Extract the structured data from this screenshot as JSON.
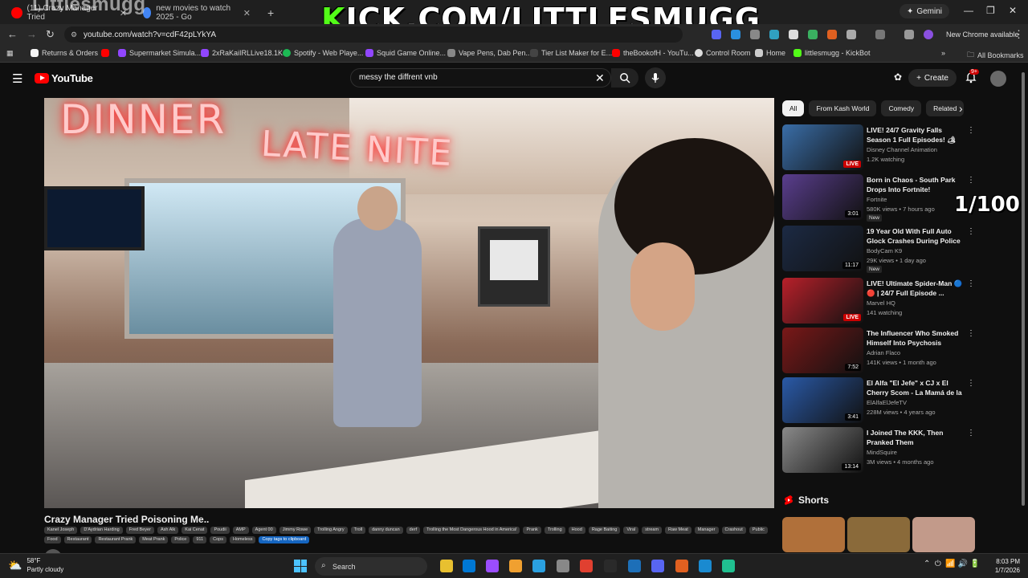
{
  "browser": {
    "tabs": [
      {
        "label": "(11) Crazy Manager Tried",
        "favicon_color": "#ff0000"
      },
      {
        "label": "new movies to watch 2025 - Go",
        "favicon_color": "#4285f4"
      }
    ],
    "new_tab_label": "+",
    "gemini_label": "Gemini",
    "url": "youtube.com/watch?v=cdF42pLYkYA",
    "new_chrome_label": "New Chrome available",
    "bookmarks": [
      {
        "label": "Returns & Orders",
        "color": "#f5f5f5"
      },
      {
        "label": "Supermarket Simula...",
        "color": "#9146ff"
      },
      {
        "label": "2xRaKaiIRLLive18.1K...",
        "color": "#9146ff"
      },
      {
        "label": "Spotify - Web Playe...",
        "color": "#1db954"
      },
      {
        "label": "Squid Game Online...",
        "color": "#9146ff"
      },
      {
        "label": "Vape Pens, Dab Pen...",
        "color": "#888888"
      },
      {
        "label": "Tier List Maker for E...",
        "color": "#444444"
      },
      {
        "label": "theBookofH - YouTu...",
        "color": "#ff0000"
      },
      {
        "label": "Control Room",
        "color": "#dddddd"
      },
      {
        "label": "Home",
        "color": "#cccccc"
      },
      {
        "label": "littlesmugg - KickBot",
        "color": "#53fc18"
      }
    ],
    "all_bookmarks_label": "All Bookmarks"
  },
  "stream_overlay": {
    "brand": "Littlesmugg",
    "kick_banner": "KICK.COM/LITTLESMUGG",
    "counter": "1/100"
  },
  "youtube": {
    "logo_text": "YouTube",
    "search_value": "messy the diffrent vnb",
    "create_label": "Create",
    "notification_count": "9+",
    "video_title": "Crazy Manager Tried Poisoning Me..",
    "sign_text_1": "DINNER",
    "sign_text_2": "LATE NITE",
    "tags": [
      "Kanel Joseph",
      "D'Aydrian Harding",
      "Fred Beyer",
      "Ash Alk",
      "Kai Cenat",
      "Poudii",
      "AMP",
      "Agent 00",
      "Jimmy Rowe",
      "Trolling Angry",
      "Troll",
      "danny duncan",
      "derf",
      "Trolling the Most Dangerous Hood in America!",
      "Prank",
      "Trolling",
      "Hood",
      "Rage Baiting",
      "Viral",
      "stream",
      "Raw Meat",
      "Manager",
      "Crashout",
      "Public",
      "Food",
      "Restaurant",
      "Restaurant Prank",
      "Meat Prank",
      "Police",
      "911",
      "Cops",
      "Homeless"
    ],
    "copy_tags_label": "Copy tags to clipboard",
    "chips": [
      "All",
      "From Kash World",
      "Comedy",
      "Related"
    ],
    "related": [
      {
        "title": "LIVE! 24/7 Gravity Falls Season 1 Full Episodes! 🏕 ✨...",
        "channel": "Disney Channel Animation",
        "meta": "1.2K watching",
        "badge": "LIVE",
        "is_live": true,
        "is_new": false,
        "thumb_color": "#3a6ea8"
      },
      {
        "title": "Born in Chaos - South Park Drops Into Fortnite!",
        "channel": "Fortnite",
        "meta": "580K views • 7 hours ago",
        "badge": "3:01",
        "is_live": false,
        "is_new": true,
        "thumb_color": "#5a3e8e"
      },
      {
        "title": "19 Year Old With Full Auto Glock Crashes During Police Chase",
        "channel": "BodyCam K9",
        "meta": "29K views • 1 day ago",
        "badge": "11:17",
        "is_live": false,
        "is_new": true,
        "thumb_color": "#1c2a44"
      },
      {
        "title": "LIVE! Ultimate Spider-Man 🔵 🔴 | 24/7 Full Episode ...",
        "channel": "Marvel HQ",
        "meta": "141 watching",
        "badge": "LIVE",
        "is_live": true,
        "is_new": false,
        "thumb_color": "#b8202a"
      },
      {
        "title": "The Influencer Who Smoked Himself Into Psychosis",
        "channel": "Adrian Flaco",
        "meta": "141K views • 1 month ago",
        "badge": "7:52",
        "is_live": false,
        "is_new": false,
        "thumb_color": "#7a1818"
      },
      {
        "title": "El Alfa \"El Jefe\" x CJ x El Cherry Scom - La Mamá de la Mamá ...",
        "channel": "ElAlfaElJefeTV",
        "meta": "228M views • 4 years ago",
        "badge": "3:41",
        "is_live": false,
        "is_new": false,
        "thumb_color": "#2a5aa8"
      },
      {
        "title": "I Joined The KKK, Then Pranked Them",
        "channel": "MindSquire",
        "meta": "3M views • 4 months ago",
        "badge": "13:14",
        "is_live": false,
        "is_new": false,
        "thumb_color": "#8a8a8a"
      }
    ],
    "new_label": "New",
    "shorts_label": "Shorts",
    "shorts_thumbs": [
      "#b0703a",
      "#8a6a3a",
      "#c29a8a"
    ]
  },
  "taskbar": {
    "temperature": "58°F",
    "weather": "Partly cloudy",
    "search_label": "Search",
    "time": "8:03 PM",
    "date": "1/7/2026",
    "apps": [
      "#e8c030",
      "#0078d4",
      "#9b4dff",
      "#f0a030",
      "#2aa0e0",
      "#888888",
      "#e04030",
      "#2a2a2a",
      "#1d6fb8",
      "#5865f2",
      "#e06020",
      "#1a8ad0",
      "#20c090"
    ]
  },
  "colors": {
    "yt_red": "#ff0000",
    "kick_green": "#53fc18",
    "bg": "#0f0f0f"
  }
}
